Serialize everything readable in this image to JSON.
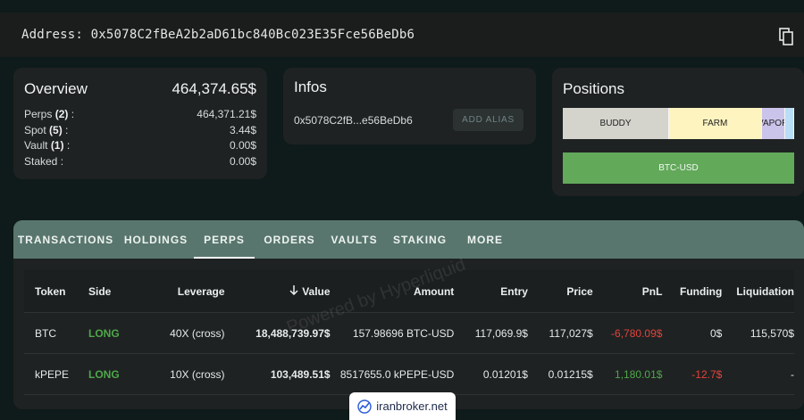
{
  "address": {
    "label": "Address:",
    "value": "0x5078C2fBeA2b2aD61bc840Bc023E35Fce56BeDb6",
    "copy_icon": "copy-icon"
  },
  "overview": {
    "title": "Overview",
    "total": "464,374.65$",
    "rows": [
      {
        "label": "Perps",
        "count": "(2)",
        "value": "464,371.21$"
      },
      {
        "label": "Spot",
        "count": "(5)",
        "value": "3.44$"
      },
      {
        "label": "Vault",
        "count": "(1)",
        "value": "0.00$"
      },
      {
        "label": "Staked",
        "count": "",
        "value": "0.00$"
      }
    ]
  },
  "infos": {
    "title": "Infos",
    "short_address": "0x5078C2fB...e56BeDb6",
    "add_alias_label": "ADD ALIAS"
  },
  "positions": {
    "title": "Positions",
    "segments": [
      {
        "label": "BUDDY",
        "color": "#d4d4cc",
        "share": 0.46
      },
      {
        "label": "FARM",
        "color": "#fdf4c0",
        "share": 0.4
      },
      {
        "label": "VAPOR",
        "color": "#cbc4ea",
        "share": 0.1
      },
      {
        "label": "",
        "color": "#b9def5",
        "share": 0.04
      }
    ],
    "btc_label": "BTC-USD",
    "btc_color": "#62a95a"
  },
  "tabs": [
    "TRANSACTIONS",
    "HOLDINGS",
    "PERPS",
    "ORDERS",
    "VAULTS",
    "STAKING",
    "MORE"
  ],
  "active_tab": "PERPS",
  "table": {
    "headers": [
      "Token",
      "Side",
      "Leverage",
      "Value",
      "Amount",
      "Entry",
      "Price",
      "PnL",
      "Funding",
      "Liquidation"
    ],
    "sort_icon": "arrow-down-icon",
    "rows": [
      {
        "token": "BTC",
        "side": "LONG",
        "leverage": "40X (cross)",
        "value": "18,488,739.97$",
        "amount": "157.98696 BTC-USD",
        "entry": "117,069.9$",
        "price": "117,027$",
        "pnl": "-6,780.09$",
        "funding": "0$",
        "liquidation": "115,570$"
      },
      {
        "token": "kPEPE",
        "side": "LONG",
        "leverage": "10X (cross)",
        "value": "103,489.51$",
        "amount": "8517655.0 kPEPE-USD",
        "entry": "0.01201$",
        "price": "0.01215$",
        "pnl": "1,180.01$",
        "funding": "-12.7$",
        "liquidation": "-"
      }
    ]
  },
  "watermark": "Powered by Hyperliquid",
  "badge": {
    "text": "iranbroker.net",
    "icon": "chart-logo-icon"
  }
}
